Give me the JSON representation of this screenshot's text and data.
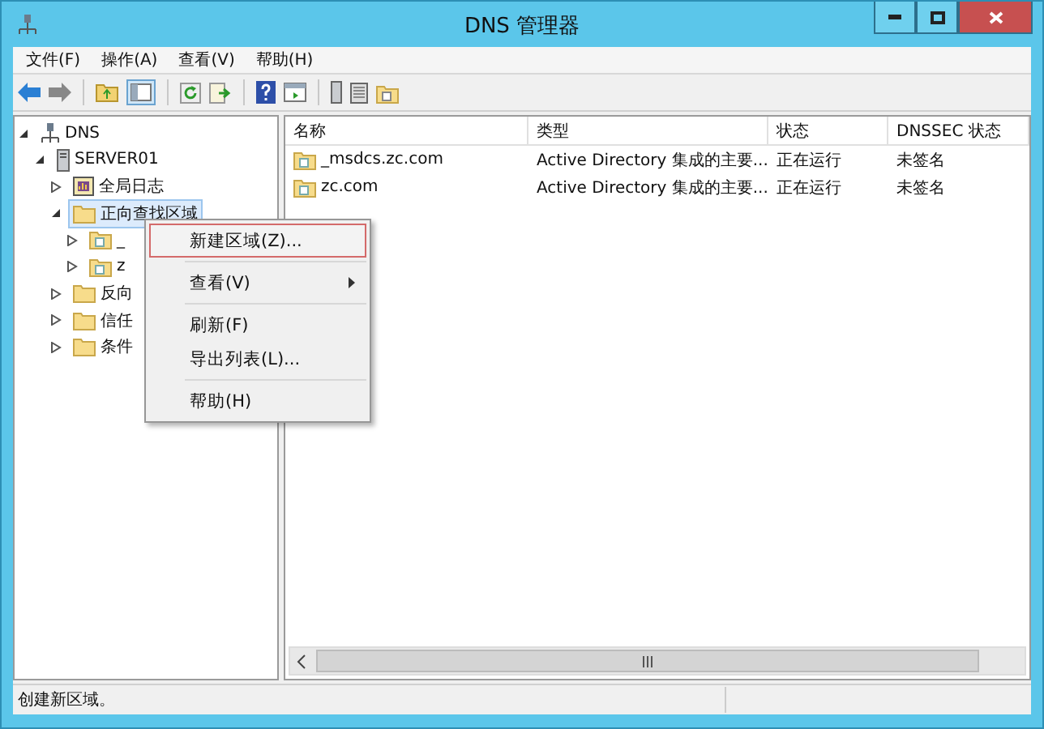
{
  "window": {
    "title": "DNS 管理器"
  },
  "menu_bar": [
    "文件(F)",
    "操作(A)",
    "查看(V)",
    "帮助(H)"
  ],
  "tree": [
    {
      "label": "DNS",
      "kind": "dns",
      "expanded": true,
      "selected": false,
      "children": [
        {
          "label": "SERVER01",
          "kind": "server",
          "expanded": true,
          "selected": false,
          "children": [
            {
              "label": "全局日志",
              "kind": "log",
              "expanded": false,
              "selected": false
            },
            {
              "label": "正向查找区域",
              "kind": "folder",
              "expanded": true,
              "selected": true,
              "children": [
                {
                  "label": "_",
                  "kind": "zone",
                  "expanded": false,
                  "selected": false
                },
                {
                  "label": "z",
                  "kind": "zone",
                  "expanded": false,
                  "selected": false
                }
              ]
            },
            {
              "label": "反向",
              "kind": "folder",
              "expanded": false,
              "selected": false
            },
            {
              "label": "信任",
              "kind": "folder",
              "expanded": false,
              "selected": false
            },
            {
              "label": "条件",
              "kind": "folder",
              "expanded": false,
              "selected": false
            }
          ]
        }
      ]
    }
  ],
  "table": {
    "columns": [
      "名称",
      "类型",
      "状态",
      "DNSSEC 状态"
    ],
    "rows": [
      {
        "name": "_msdcs.zc.com",
        "type": "Active Directory 集成的主要...",
        "status": "正在运行",
        "dnssec": "未签名"
      },
      {
        "name": "zc.com",
        "type": "Active Directory 集成的主要...",
        "status": "正在运行",
        "dnssec": "未签名"
      }
    ]
  },
  "context_menu": [
    {
      "kind": "item",
      "label": "新建区域(Z)...",
      "selected": true,
      "submenu": false
    },
    {
      "kind": "separator"
    },
    {
      "kind": "item",
      "label": "查看(V)",
      "selected": false,
      "submenu": true
    },
    {
      "kind": "separator"
    },
    {
      "kind": "item",
      "label": "刷新(F)",
      "selected": false,
      "submenu": false
    },
    {
      "kind": "item",
      "label": "导出列表(L)...",
      "selected": false,
      "submenu": false
    },
    {
      "kind": "separator"
    },
    {
      "kind": "item",
      "label": "帮助(H)",
      "selected": false,
      "submenu": false
    }
  ],
  "status_bar": "创建新区域。"
}
